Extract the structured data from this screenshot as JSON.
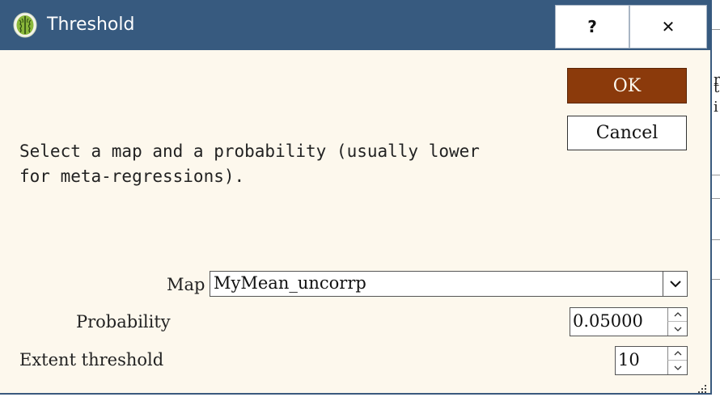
{
  "window": {
    "title": "Threshold",
    "help_label": "?",
    "close_label": "✕"
  },
  "buttons": {
    "ok_label": "OK",
    "cancel_label": "Cancel"
  },
  "message": "Select a map and a probability (usually lower\nfor meta-regressions).",
  "form": {
    "map_label": "Map",
    "map_value": "MyMean_uncorrp",
    "probability_label": "Probability",
    "probability_value": "0.05000",
    "extent_label": "Extent threshold",
    "extent_value": "10"
  },
  "background_editor": {
    "visible_chars": [
      "r",
      "t",
      "i"
    ]
  },
  "colors": {
    "titlebar": "#375a7f",
    "dialog_bg": "#fdf8ed",
    "ok_button": "#8b3a0b"
  },
  "icons": [
    "brain-app-icon",
    "chevron-down-icon",
    "spin-up-icon",
    "spin-down-icon",
    "resize-grip-icon"
  ]
}
